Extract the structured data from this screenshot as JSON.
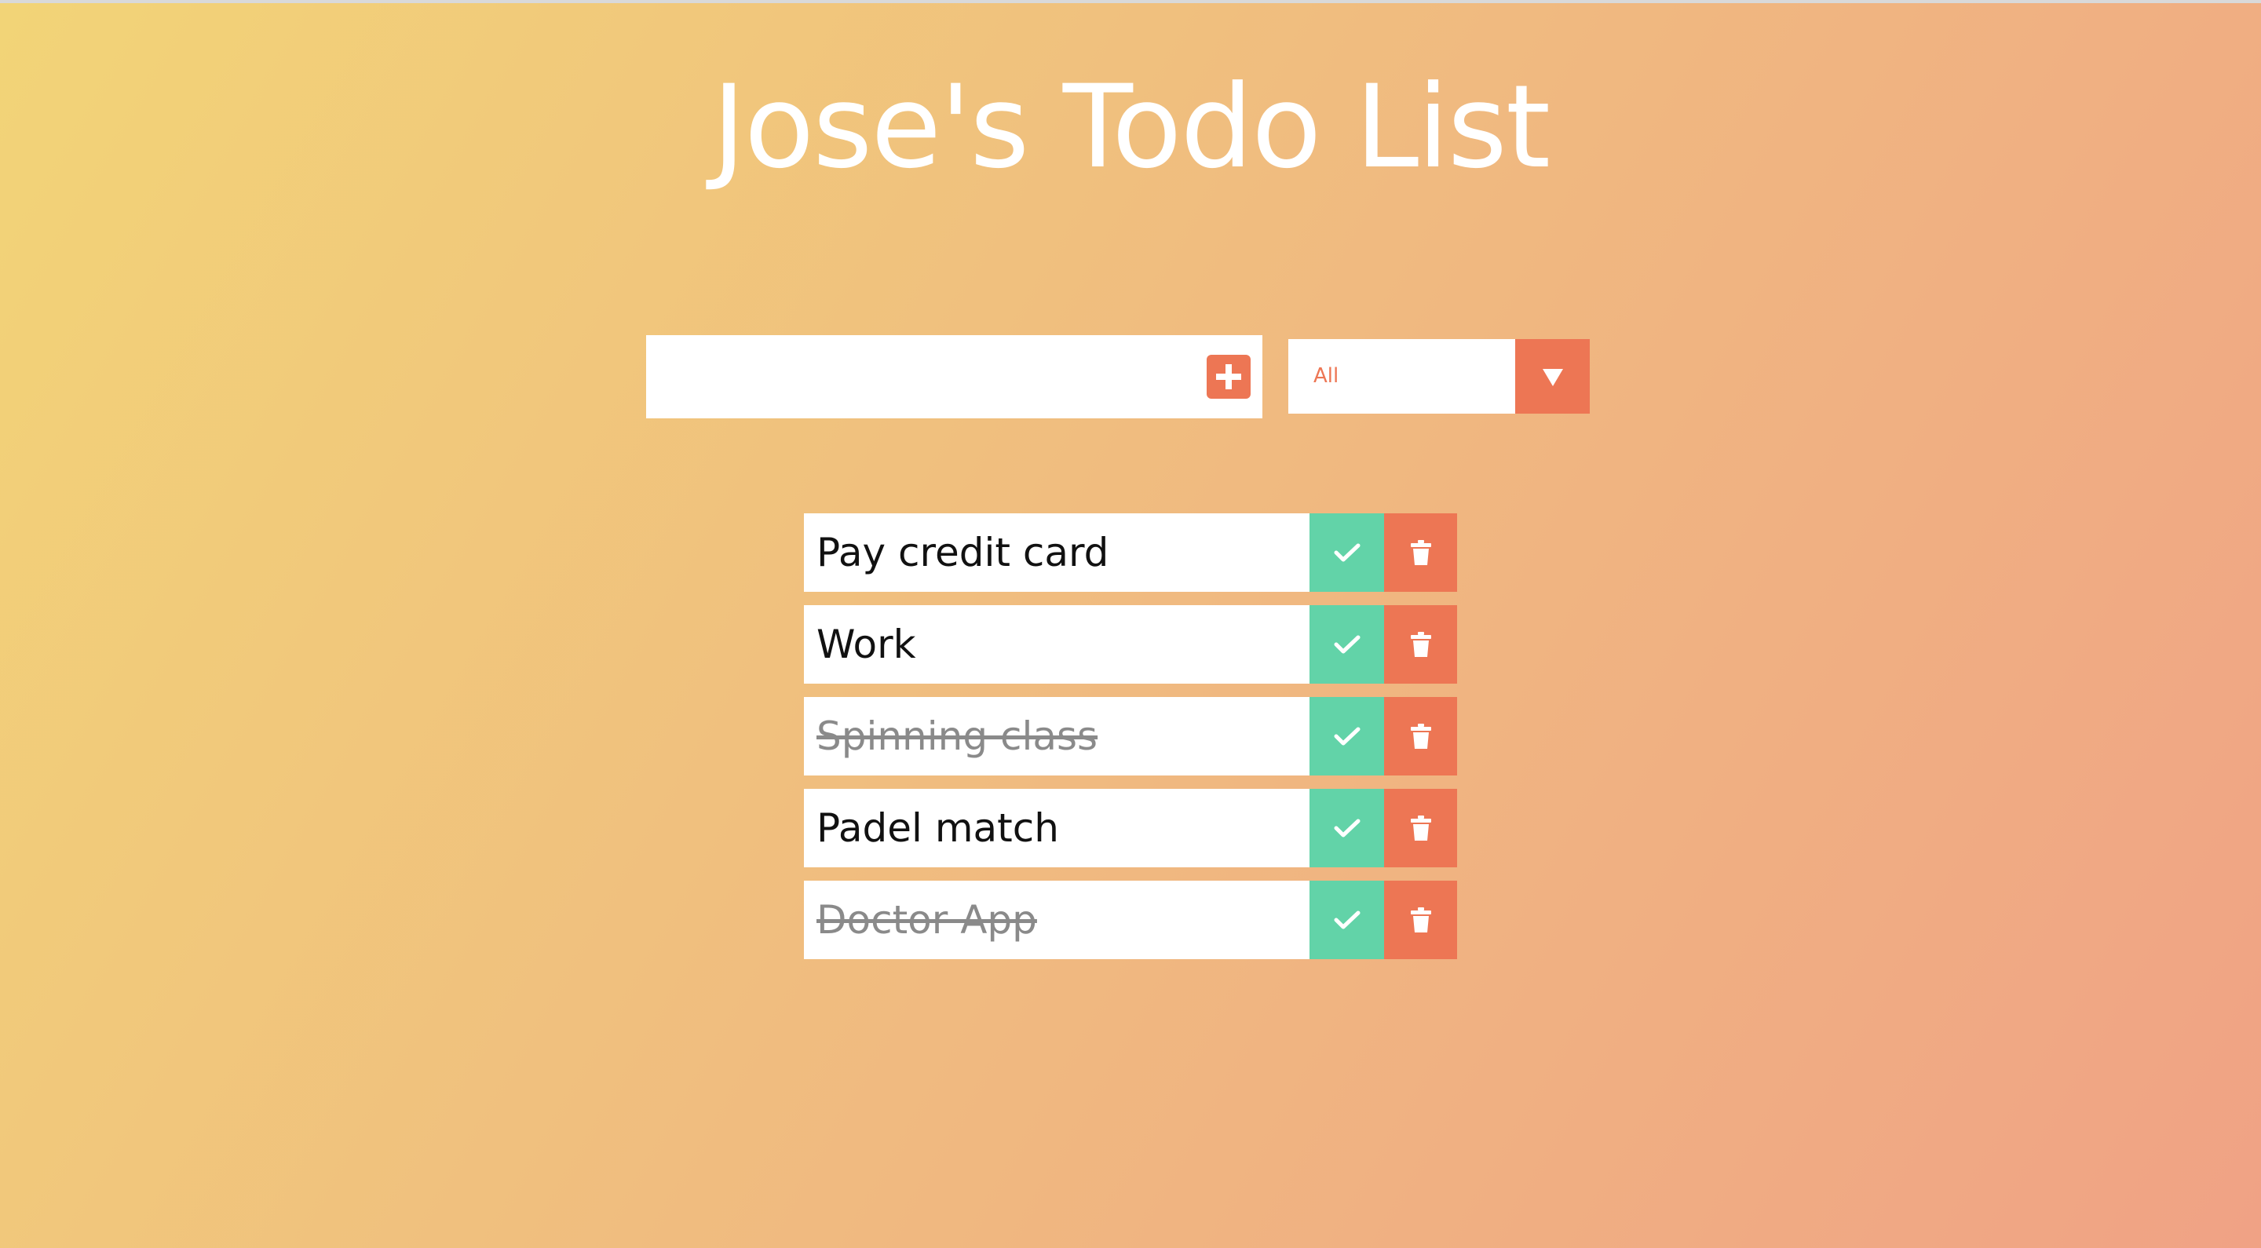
{
  "header": {
    "title": "Jose's Todo List"
  },
  "form": {
    "input_value": "",
    "input_placeholder": "",
    "add_icon": "plus-square-icon",
    "filter": {
      "selected": "All",
      "arrow_icon": "caret-down-icon"
    }
  },
  "todos": [
    {
      "text": "Pay credit card",
      "completed": false
    },
    {
      "text": "Work",
      "completed": false
    },
    {
      "text": "Spinning class",
      "completed": true
    },
    {
      "text": "Padel match",
      "completed": false
    },
    {
      "text": "Doctor App",
      "completed": true
    }
  ],
  "icons": {
    "complete": "check-icon",
    "delete": "trash-icon"
  },
  "colors": {
    "gradient_start": "#f2d477",
    "gradient_end": "#f0a285",
    "accent": "#ed7654",
    "complete": "#62d3a8",
    "title": "#ffffff"
  }
}
